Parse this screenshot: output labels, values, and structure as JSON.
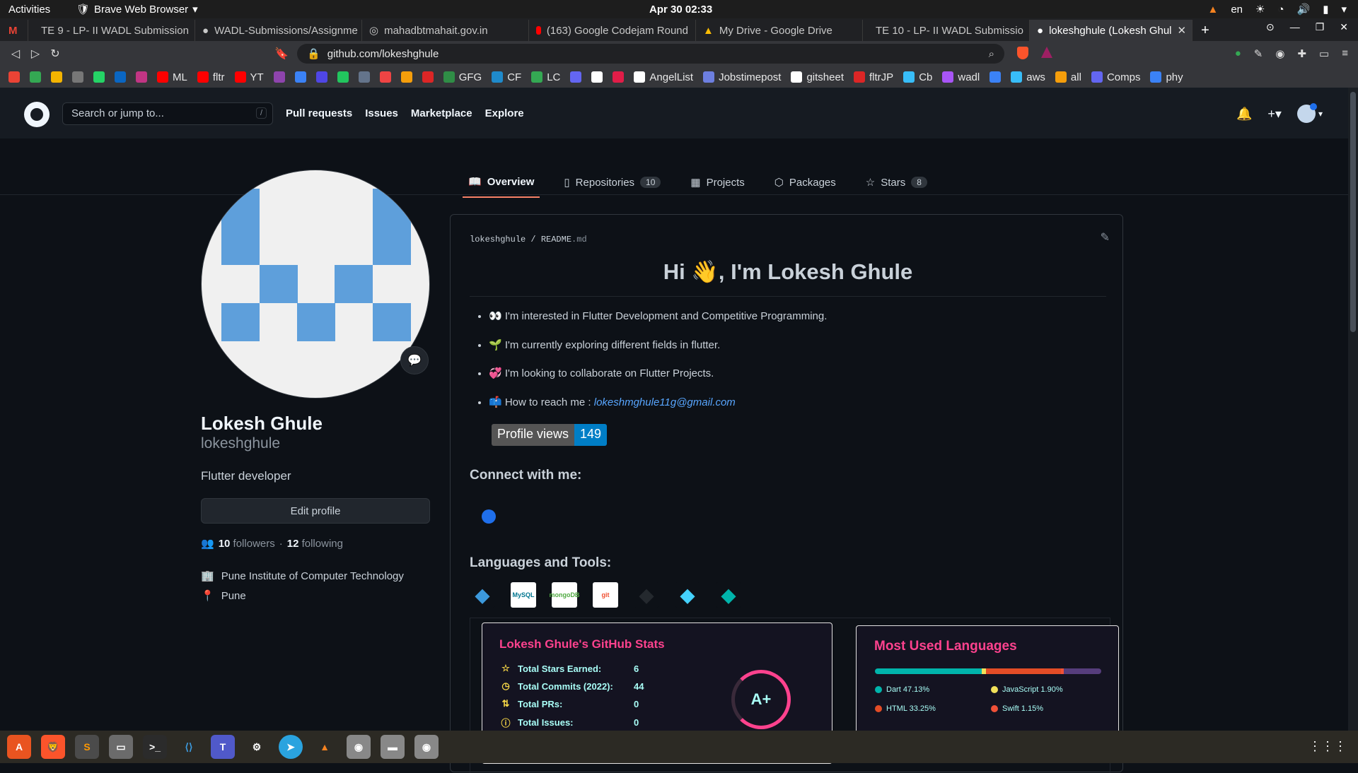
{
  "system": {
    "activities": "Activities",
    "app_name": "Brave Web Browser",
    "clock": "Apr 30  02:33",
    "lang": "en"
  },
  "tabs": [
    {
      "label": "",
      "icon": "gmail-icon"
    },
    {
      "label": "TE 9 - LP- II WADL Submission",
      "icon": "sheets-icon"
    },
    {
      "label": "WADL-Submissions/Assignme",
      "icon": "github-icon"
    },
    {
      "label": "mahadbtmahait.gov.in",
      "icon": "globe-icon"
    },
    {
      "label": "(163) Google Codejam Round",
      "icon": "youtube-icon"
    },
    {
      "label": "My Drive - Google Drive",
      "icon": "drive-icon"
    },
    {
      "label": "TE 10 - LP- II WADL Submissio",
      "icon": "sheets-icon"
    },
    {
      "label": "lokeshghule (Lokesh Ghul",
      "icon": "github-icon"
    }
  ],
  "address": {
    "url": "github.com/lokeshghule"
  },
  "bookmarks": [
    {
      "label": "",
      "color": "#ea4335"
    },
    {
      "label": "",
      "color": "#34a853"
    },
    {
      "label": "",
      "color": "#f4b400"
    },
    {
      "label": "",
      "color": "#777777"
    },
    {
      "label": "",
      "color": "#25d366"
    },
    {
      "label": "",
      "color": "#0a66c2"
    },
    {
      "label": "",
      "color": "#c13584"
    },
    {
      "label": "ML",
      "color": "#ff0000"
    },
    {
      "label": "fltr",
      "color": "#ff0000"
    },
    {
      "label": "YT",
      "color": "#ff0000"
    },
    {
      "label": "",
      "color": "#8e44ad"
    },
    {
      "label": "",
      "color": "#3b82f6"
    },
    {
      "label": "",
      "color": "#4f46e5"
    },
    {
      "label": "",
      "color": "#22c55e"
    },
    {
      "label": "",
      "color": "#64748b"
    },
    {
      "label": "",
      "color": "#ef4444"
    },
    {
      "label": "",
      "color": "#f59e0b"
    },
    {
      "label": "",
      "color": "#dc2626"
    },
    {
      "label": "GFG",
      "color": "#2f8d46"
    },
    {
      "label": "CF",
      "color": "#1f8acb"
    },
    {
      "label": "LC",
      "color": "#34a853"
    },
    {
      "label": "",
      "color": "#6366f1"
    },
    {
      "label": "",
      "color": "#ffffff"
    },
    {
      "label": "",
      "color": "#e11d48"
    },
    {
      "label": "AngelList",
      "color": "#ffffff"
    },
    {
      "label": "Jobstimepost",
      "color": "#6d7fe0"
    },
    {
      "label": "gitsheet",
      "color": "#ffffff"
    },
    {
      "label": "fltrJP",
      "color": "#dc2626"
    },
    {
      "label": "Cb",
      "color": "#38bdf8"
    },
    {
      "label": "wadl",
      "color": "#a855f7"
    },
    {
      "label": "",
      "color": "#3b82f6"
    },
    {
      "label": "aws",
      "color": "#38bdf8"
    },
    {
      "label": "all",
      "color": "#f59e0b"
    },
    {
      "label": "Comps",
      "color": "#6366f1"
    },
    {
      "label": "phy",
      "color": "#3b82f6"
    }
  ],
  "gh": {
    "search_placeholder": "Search or jump to...",
    "slash": "/",
    "nav": [
      "Pull requests",
      "Issues",
      "Marketplace",
      "Explore"
    ]
  },
  "profile_tabs": [
    {
      "label": "Overview",
      "count": ""
    },
    {
      "label": "Repositories",
      "count": "10"
    },
    {
      "label": "Projects",
      "count": ""
    },
    {
      "label": "Packages",
      "count": ""
    },
    {
      "label": "Stars",
      "count": "8"
    }
  ],
  "profile": {
    "name": "Lokesh Ghule",
    "login": "lokeshghule",
    "bio": "Flutter developer",
    "edit": "Edit profile",
    "followers_count": "10",
    "followers_label": "followers",
    "sep": "·",
    "following_count": "12",
    "following_label": "following",
    "org": "Pune Institute of Computer Technology",
    "location": "Pune"
  },
  "readme": {
    "owner": "lokeshghule",
    "sep": "/",
    "file": "README",
    "ext": ".md",
    "title": "Hi 👋, I'm Lokesh Ghule",
    "items": [
      "👀 I'm interested in Flutter Development and Competitive Programming.",
      "🌱 I'm currently exploring different fields in flutter.",
      "💞️ I'm looking to collaborate on Flutter Projects."
    ],
    "reach_label": "📫 How to reach me : ",
    "email": "lokeshmghule11g@gmail.com",
    "views_label": "Profile views",
    "views_count": "149",
    "connect": "Connect with me:",
    "languages": "Languages and Tools:",
    "tools": [
      {
        "name": "vscode",
        "text": "",
        "bg": "#0d1117",
        "fg": "#3c99dc"
      },
      {
        "name": "mysql",
        "text": "MySQL",
        "bg": "#ffffff",
        "fg": "#00758f"
      },
      {
        "name": "mongodb",
        "text": "mongoDB",
        "bg": "#ffffff",
        "fg": "#4faa41"
      },
      {
        "name": "git",
        "text": "git",
        "bg": "#ffffff",
        "fg": "#f05032"
      },
      {
        "name": "github",
        "text": "",
        "bg": "#0d1117",
        "fg": "#24292e"
      },
      {
        "name": "flutter",
        "text": "",
        "bg": "#0d1117",
        "fg": "#44d1fd"
      },
      {
        "name": "dart",
        "text": "",
        "bg": "#0d1117",
        "fg": "#00b4ab"
      }
    ]
  },
  "stats": {
    "title": "Lokesh Ghule's GitHub Stats",
    "rows": [
      {
        "label": "Total Stars Earned:",
        "value": "6"
      },
      {
        "label": "Total Commits (2022):",
        "value": "44"
      },
      {
        "label": "Total PRs:",
        "value": "0"
      },
      {
        "label": "Total Issues:",
        "value": "0"
      }
    ],
    "grade": "A+"
  },
  "langs": {
    "title": "Most Used Languages",
    "items": [
      {
        "label": "Dart 47.13%",
        "pct": 47.13,
        "color": "#00b4ab"
      },
      {
        "label": "JavaScript 1.90%",
        "pct": 1.9,
        "color": "#f1e05a"
      },
      {
        "label": "HTML 33.25%",
        "pct": 33.25,
        "color": "#e34c26"
      },
      {
        "label": "Swift 1.15%",
        "pct": 1.15,
        "color": "#f05138"
      },
      {
        "label": "",
        "pct": 16.57,
        "color": "#563d7c"
      }
    ]
  },
  "colors": {
    "accent": "#fe428e",
    "stat_text": "#a9fef7",
    "link": "#58a6ff",
    "tab_underline": "#f78166"
  }
}
